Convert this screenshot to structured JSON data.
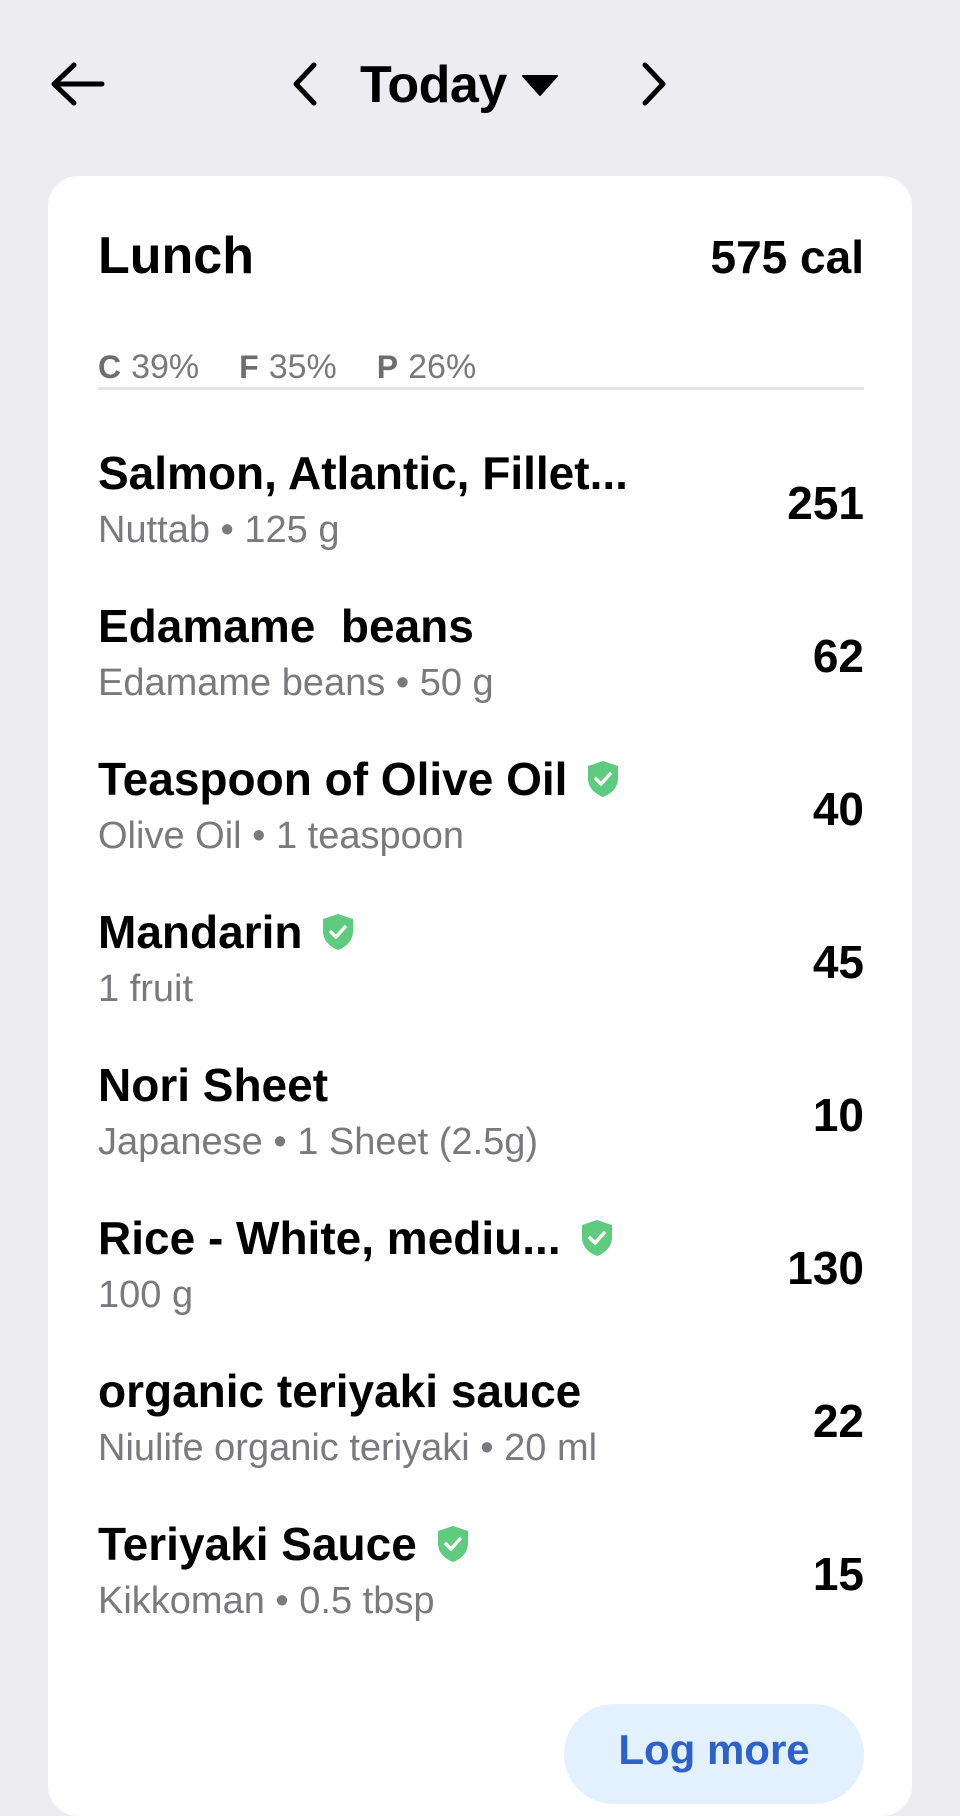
{
  "header": {
    "date_label": "Today"
  },
  "meal": {
    "title": "Lunch",
    "calories": "575 cal",
    "macros": [
      {
        "letter": "C",
        "value": "39%"
      },
      {
        "letter": "F",
        "value": "35%"
      },
      {
        "letter": "P",
        "value": "26%"
      }
    ]
  },
  "foods": [
    {
      "name": "Salmon, Atlantic, Fillet...",
      "detail": "Nuttab • 125 g",
      "calories": "251",
      "verified": false
    },
    {
      "name": "Edamame  beans",
      "detail": "Edamame beans • 50 g",
      "calories": "62",
      "verified": false
    },
    {
      "name": "Teaspoon of Olive Oil",
      "detail": "Olive Oil • 1 teaspoon",
      "calories": "40",
      "verified": true
    },
    {
      "name": "Mandarin",
      "detail": "1 fruit",
      "calories": "45",
      "verified": true
    },
    {
      "name": "Nori Sheet",
      "detail": "Japanese • 1 Sheet (2.5g)",
      "calories": "10",
      "verified": false
    },
    {
      "name": "Rice - White, mediu...",
      "detail": "100 g",
      "calories": "130",
      "verified": true
    },
    {
      "name": "organic teriyaki sauce",
      "detail": "Niulife organic teriyaki • 20 ml",
      "calories": "22",
      "verified": false
    },
    {
      "name": "Teriyaki Sauce",
      "detail": "Kikkoman • 0.5 tbsp",
      "calories": "15",
      "verified": true
    }
  ],
  "actions": {
    "log_more_label": "Log more"
  },
  "colors": {
    "background": "#ECECF1",
    "verified_badge": "#5FCB7E",
    "log_more_text": "#2C62C9",
    "log_more_bg": "#E3F0FD"
  },
  "icons": {
    "back": "arrow-left-icon",
    "prev": "chevron-left-icon",
    "next": "chevron-right-icon",
    "dropdown": "caret-down-icon",
    "verified": "shield-check-icon"
  }
}
